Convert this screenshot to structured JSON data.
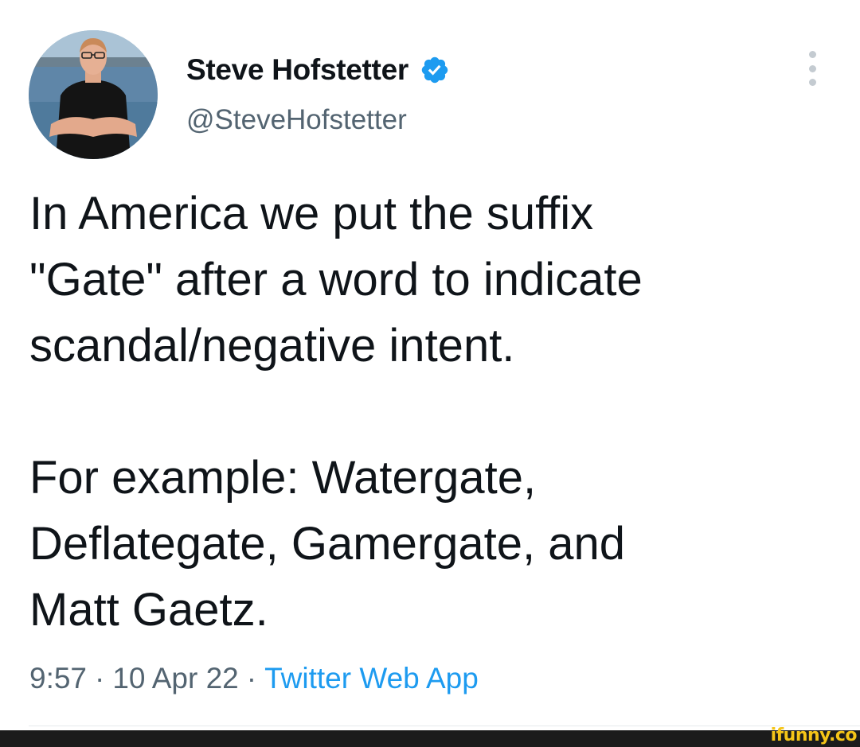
{
  "author": {
    "display_name": "Steve Hofstetter",
    "handle": "@SteveHofstetter",
    "verified": true
  },
  "tweet": {
    "paragraphs": [
      "In America we put the suffix\n\"Gate\" after a word to indicate\nscandal/negative intent.",
      "For example: Watergate,\nDeflategate, Gamergate, and\nMatt Gaetz."
    ],
    "time": "9:57",
    "separator": "·",
    "date": "10 Apr 22",
    "source": "Twitter Web App"
  },
  "watermark": "ifunny.co",
  "icons": {
    "verified": "verified-badge-icon",
    "more": "more-options-icon"
  },
  "colors": {
    "text": "#0f1419",
    "secondary": "#536471",
    "accent": "#1d9bf0"
  }
}
